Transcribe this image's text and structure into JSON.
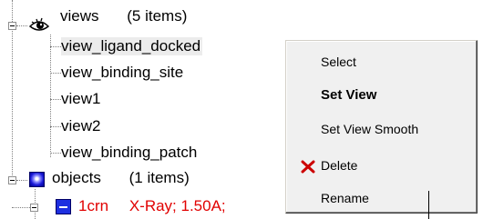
{
  "tree": {
    "views": {
      "label": "views",
      "count": "(5 items)",
      "items": [
        {
          "label": "view_ligand_docked"
        },
        {
          "label": "view_binding_site"
        },
        {
          "label": "view1"
        },
        {
          "label": "view2"
        },
        {
          "label": "view_binding_patch"
        }
      ]
    },
    "objects": {
      "label": "objects",
      "count": "(1 items)",
      "molecule": {
        "label": "1crn",
        "info": "X-Ray; 1.50A;"
      }
    }
  },
  "context_menu": {
    "items": [
      {
        "label": "Select"
      },
      {
        "label": "Set View"
      },
      {
        "label": "Set View Smooth"
      },
      {
        "label": "Delete",
        "icon": "red-x-icon"
      },
      {
        "label": "Rename"
      }
    ]
  },
  "icons": {
    "views": "eye-icon",
    "objects": "blue-sphere-icon",
    "molecule": "molecule-icon",
    "expander": "minus-box-icon"
  },
  "colors": {
    "selection": "#ececec",
    "molecule_text": "#e10000",
    "menu_bg": "#f0f0f0",
    "delete_icon": "#cc0000"
  }
}
